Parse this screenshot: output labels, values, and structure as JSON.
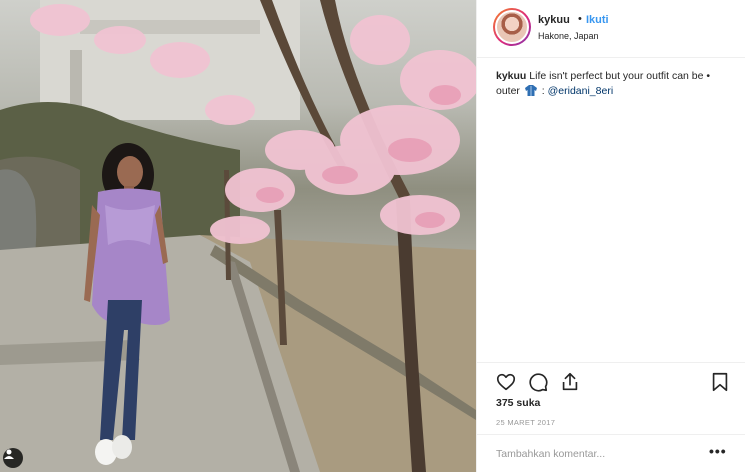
{
  "post": {
    "username": "kykuu",
    "separator": "•",
    "follow_label": "Ikuti",
    "location": "Hakone, Japan",
    "caption": {
      "username": "kykuu",
      "text": "Life isn't perfect but your outfit can be • outter",
      "text_before_icon": "Life isn't perfect but your outfit can be • outer",
      "after_icon": ":",
      "mention": "@eridani_8eri",
      "icon": "coat-icon"
    },
    "likes": "375 suka",
    "date": "25 MARET 2017",
    "comment_placeholder": "Tambahkan komentar...",
    "more_label": "•••"
  },
  "icons": {
    "like": "heart-icon",
    "comment": "comment-icon",
    "share": "share-icon",
    "save": "bookmark-icon",
    "user_tag": "user-tag-icon"
  },
  "colors": {
    "link": "#3897f0",
    "mention": "#003569",
    "text": "#262626",
    "muted": "#999999",
    "border": "#efefef"
  }
}
